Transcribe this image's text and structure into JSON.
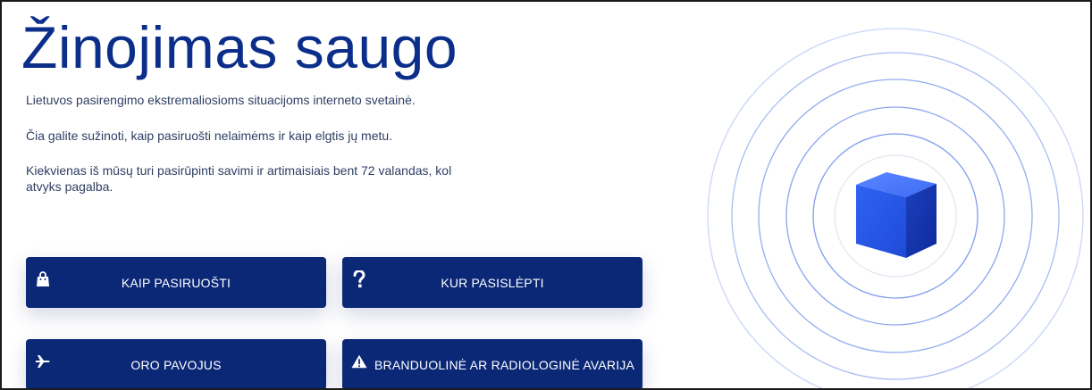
{
  "hero": {
    "title": "Žinojimas saugo",
    "paragraphs": [
      "Lietuvos pasirengimo ekstremaliosioms situacijoms interneto svetainė.",
      "Čia galite sužinoti, kaip pasiruošti nelaimėms ir kaip elgtis jų metu.",
      "Kiekvienas iš mūsų turi pasirūpinti savimi ir artimaisiais bent 72 valandas, kol atvyks pagalba."
    ]
  },
  "buttons": [
    {
      "label": "KAIP PASIRUOŠTI",
      "icon": "bag-icon"
    },
    {
      "label": "KUR PASISLĖPTI",
      "icon": "question-icon"
    },
    {
      "label": "ORO PAVOJUS",
      "icon": "airplane-icon"
    },
    {
      "label": "BRANDUOLINĖ AR RADIOLOGINĖ AVARIJA",
      "icon": "warning-icon"
    }
  ],
  "colors": {
    "primary": "#0b2877",
    "title": "#0b2e8a",
    "text": "#2d3e63",
    "cube": "#2f5ff0"
  }
}
